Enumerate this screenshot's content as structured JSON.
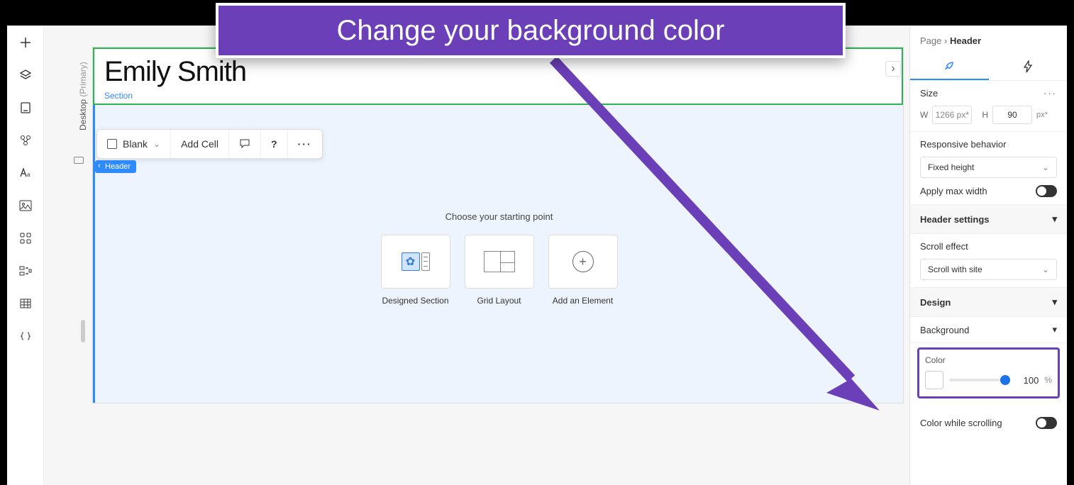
{
  "callout": {
    "text": "Change your background color"
  },
  "rail": {
    "items": [
      "add",
      "layers",
      "inspector",
      "assets",
      "text",
      "image",
      "grid",
      "components",
      "data",
      "code"
    ]
  },
  "viewport": {
    "device": "Desktop",
    "tag": "(Primary)"
  },
  "header": {
    "title": "Emily Smith",
    "sub": "Section"
  },
  "floatbar": {
    "blank": "Blank",
    "addcell": "Add Cell"
  },
  "selection_tag": "Header",
  "starter": {
    "prompt": "Choose your starting point",
    "cards": [
      {
        "label": "Designed Section"
      },
      {
        "label": "Grid Layout"
      },
      {
        "label": "Add an Element"
      }
    ]
  },
  "panel": {
    "breadcrumb": {
      "page": "Page",
      "sep": "›",
      "current": "Header"
    },
    "size": {
      "label": "Size",
      "w_label": "W",
      "w_value": "1266 px*",
      "h_label": "H",
      "h_value": "90",
      "h_unit": "px*"
    },
    "responsive": {
      "label": "Responsive behavior",
      "value": "Fixed height"
    },
    "maxwidth": {
      "label": "Apply max width"
    },
    "headersettings": {
      "label": "Header settings"
    },
    "scroll": {
      "label": "Scroll effect",
      "value": "Scroll with site"
    },
    "design": {
      "label": "Design"
    },
    "background": {
      "label": "Background"
    },
    "color": {
      "label": "Color",
      "opacity": "100",
      "unit": "%"
    },
    "colorscroll": {
      "label": "Color while scrolling"
    }
  }
}
